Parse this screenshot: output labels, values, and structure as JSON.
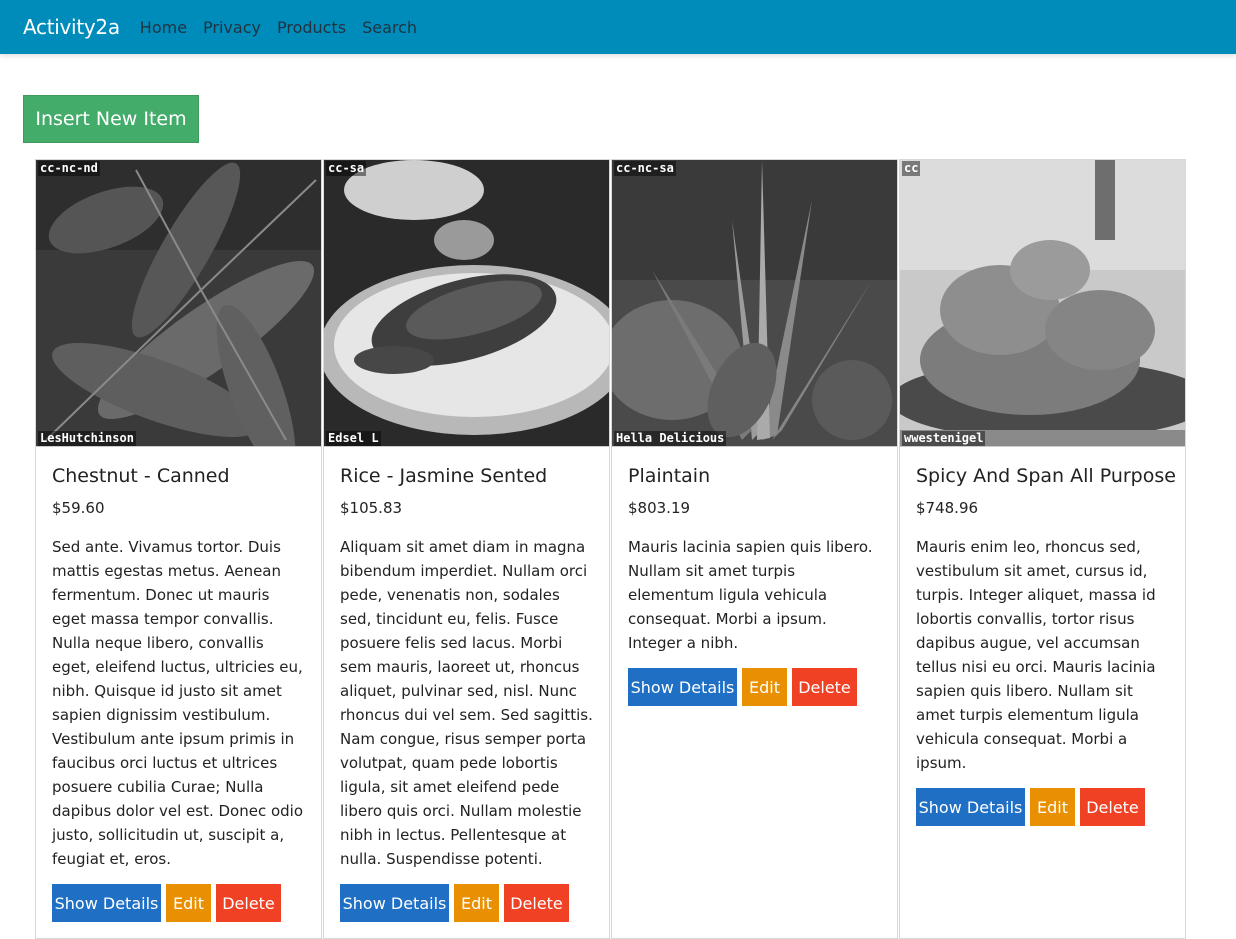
{
  "navbar": {
    "brand": "Activity2a",
    "links": [
      "Home",
      "Privacy",
      "Products",
      "Search"
    ]
  },
  "insert_button": "Insert New Item",
  "buttons": {
    "show": "Show Details",
    "edit": "Edit",
    "delete": "Delete"
  },
  "products": [
    {
      "license": "cc-nc-nd",
      "credit": "LesHutchinson",
      "image_subject": "leaf",
      "title": "Chestnut - Canned",
      "price": "$59.60",
      "description": "Sed ante. Vivamus tortor. Duis mattis egestas metus. Aenean fermentum. Donec ut mauris eget massa tempor convallis. Nulla neque libero, convallis eget, eleifend luctus, ultricies eu, nibh. Quisque id justo sit amet sapien dignissim vestibulum. Vestibulum ante ipsum primis in faucibus orci luctus et ultrices posuere cubilia Curae; Nulla dapibus dolor vel est. Donec odio justo, sollicitudin ut, suscipit a, feugiat et, eros."
    },
    {
      "license": "cc-sa",
      "credit": "Edsel L",
      "image_subject": "plated-meat",
      "title": "Rice - Jasmine Sented",
      "price": "$105.83",
      "description": "Aliquam sit amet diam in magna bibendum imperdiet. Nullam orci pede, venenatis non, sodales sed, tincidunt eu, felis. Fusce posuere felis sed lacus. Morbi sem mauris, laoreet ut, rhoncus aliquet, pulvinar sed, nisl. Nunc rhoncus dui vel sem. Sed sagittis. Nam congue, risus semper porta volutpat, quam pede lobortis ligula, sit amet eleifend pede libero quis orci. Nullam molestie nibh in lectus. Pellentesque at nulla. Suspendisse potenti."
    },
    {
      "license": "cc-nc-sa",
      "credit": "Hella Delicious",
      "image_subject": "plant",
      "title": "Plaintain",
      "price": "$803.19",
      "description": "Mauris lacinia sapien quis libero. Nullam sit amet turpis elementum ligula vehicula consequat. Morbi a ipsum. Integer a nibh."
    },
    {
      "license": "cc",
      "credit": "wwestenigel",
      "image_subject": "fried-food",
      "title": "Spicy And Span All Purpose",
      "price": "$748.96",
      "description": "Mauris enim leo, rhoncus sed, vestibulum sit amet, cursus id, turpis. Integer aliquet, massa id lobortis convallis, tortor risus dapibus augue, vel accumsan tellus nisi eu orci. Mauris lacinia sapien quis libero. Nullam sit amet turpis elementum ligula vehicula consequat. Morbi a ipsum."
    }
  ]
}
